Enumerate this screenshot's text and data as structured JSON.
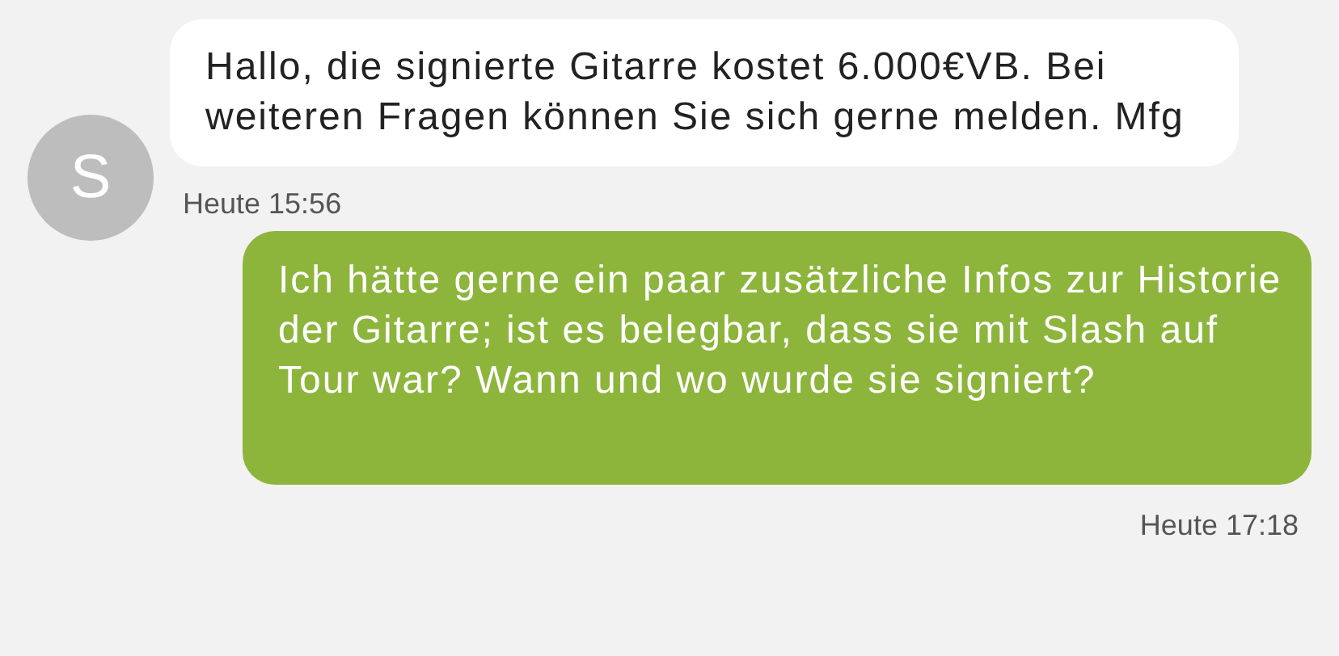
{
  "messages": [
    {
      "kind": "incoming",
      "avatar": "S",
      "text": "Hallo, die signierte Gitarre kostet 6.000€VB. Bei weiteren Fragen können Sie sich gerne melden. Mfg",
      "time": "Heute 15:56"
    },
    {
      "kind": "outgoing",
      "text": "Ich hätte gerne ein paar zusätzliche Infos zur Historie der Gitarre; ist es belegbar, dass sie mit Slash auf Tour war? Wann und wo wurde sie signiert?",
      "time": "Heute 17:18"
    }
  ]
}
